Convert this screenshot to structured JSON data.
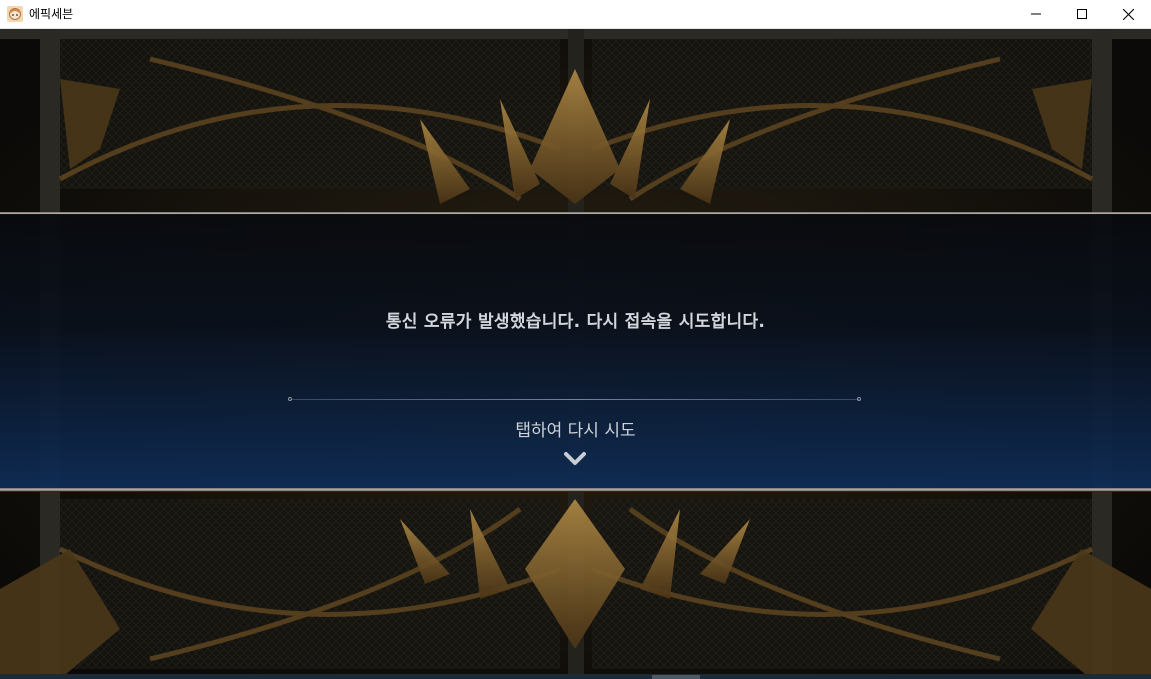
{
  "window": {
    "title": "에픽세븐",
    "controls": [
      "minimize-icon",
      "maximize-icon",
      "close-icon"
    ]
  },
  "dialog": {
    "message": "통신 오류가 발생했습니다. 다시 접속을 시도합니다.",
    "retry_label": "탭하여 다시 시도",
    "retry_icon": "chevron-down-icon"
  },
  "colors": {
    "banner_top": "#0a0c10",
    "banner_bottom": "#0e2d58",
    "text": "#d3d6da",
    "gold": "#8a6a30"
  }
}
